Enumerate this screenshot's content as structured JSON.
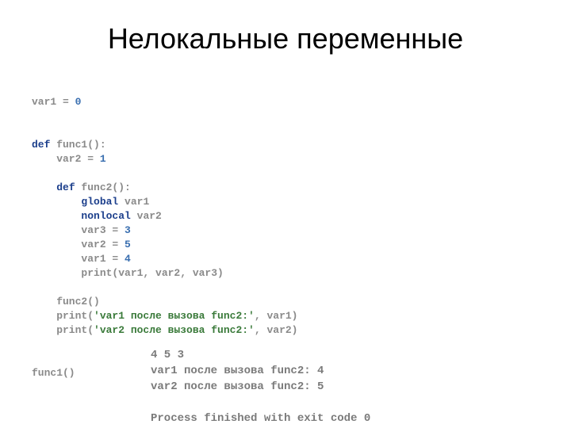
{
  "title": "Нелокальные переменные",
  "code": {
    "l1_a": "var1 = ",
    "l1_b": "0",
    "l2_a": "def",
    "l2_b": " func1():",
    "l3_a": "    var2 = ",
    "l3_b": "1",
    "l4_a": "    ",
    "l4_b": "def",
    "l4_c": " func2():",
    "l5_a": "        ",
    "l5_b": "global",
    "l5_c": " var1",
    "l6_a": "        ",
    "l6_b": "nonlocal",
    "l6_c": " var2",
    "l7_a": "        var3 = ",
    "l7_b": "3",
    "l8_a": "        var2 = ",
    "l8_b": "5",
    "l9_a": "        var1 = ",
    "l9_b": "4",
    "l10": "        print(var1, var2, var3)",
    "l11": "    func2()",
    "l12_a": "    print(",
    "l12_b": "'var1 после вызова func2:'",
    "l12_c": ", var1)",
    "l13_a": "    print(",
    "l13_b": "'var2 после вызова func2:'",
    "l13_c": ", var2)",
    "l14": "func1()"
  },
  "output": {
    "l1": "4 5 3",
    "l2": "var1 после вызова func2: 4",
    "l3": "var2 после вызова func2: 5",
    "l4": "Process finished with exit code 0"
  }
}
